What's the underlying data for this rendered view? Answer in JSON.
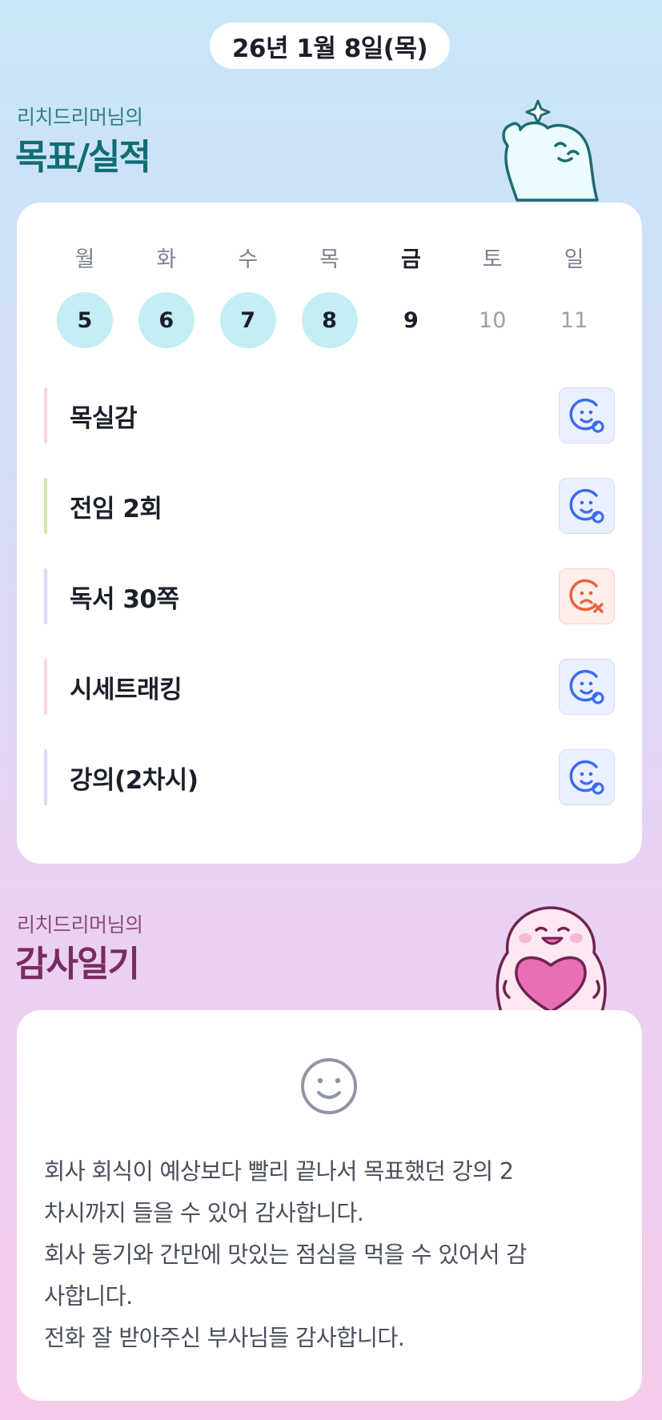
{
  "header": {
    "date": "26년 1월 8일(목)"
  },
  "goals_section": {
    "subtitle": "리치드리머님의",
    "title": "목표/실적",
    "week": {
      "days": [
        {
          "dow": "월",
          "date": "5",
          "state": "done"
        },
        {
          "dow": "화",
          "date": "6",
          "state": "done"
        },
        {
          "dow": "수",
          "date": "7",
          "state": "done"
        },
        {
          "dow": "목",
          "date": "8",
          "state": "done"
        },
        {
          "dow": "금",
          "date": "9",
          "state": "today"
        },
        {
          "dow": "토",
          "date": "10",
          "state": "future"
        },
        {
          "dow": "일",
          "date": "11",
          "state": "future"
        }
      ]
    },
    "items": [
      {
        "label": "목실감",
        "bar_color": "#f9d6d2",
        "status": "success",
        "icon": "smile-check-icon"
      },
      {
        "label": "전임 2회",
        "bar_color": "#cfe8a6",
        "status": "success",
        "icon": "smile-check-icon"
      },
      {
        "label": "독서 30쪽",
        "bar_color": "#d3def7",
        "status": "fail",
        "icon": "sad-x-icon"
      },
      {
        "label": "시세트래킹",
        "bar_color": "#f9d6d2",
        "status": "success",
        "icon": "smile-check-icon"
      },
      {
        "label": "강의(2차시)",
        "bar_color": "#d3def7",
        "status": "success",
        "icon": "smile-check-icon"
      }
    ]
  },
  "thanks_section": {
    "subtitle": "리치드리머님의",
    "title": "감사일기",
    "mood_icon": "smile-face-icon",
    "lines": [
      "회사 회식이 예상보다 빨리 끝나서 목표했던 강의 2",
      "차시까지 들을 수 있어 감사합니다.",
      "회사 동기와 간만에 맛있는 점심을 먹을 수 있어서 감",
      "사합니다.",
      "전화 잘 받아주신 부사님들 감사합니다."
    ]
  },
  "colors": {
    "success": "#3b6cf0",
    "fail": "#e8623f",
    "done_day": "#c3eef3",
    "goal_title": "#0f6d73",
    "thanks_title": "#7a2b63"
  }
}
